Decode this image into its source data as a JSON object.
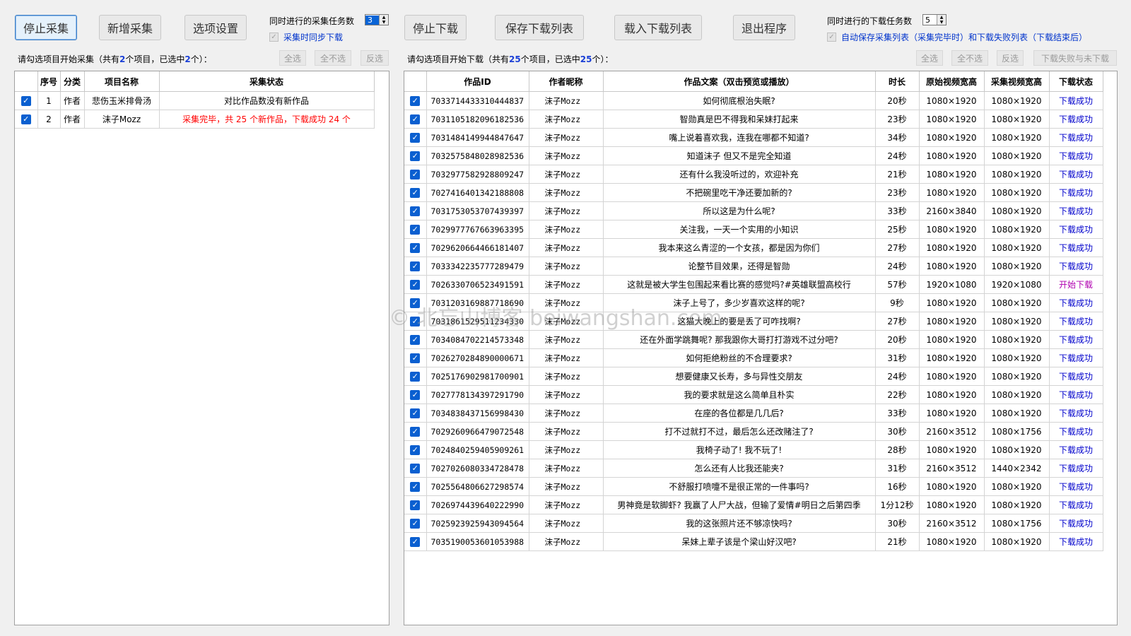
{
  "toolbar": {
    "stop_collect": "停止采集",
    "add_collect": "新增采集",
    "options": "选项设置",
    "stop_download": "停止下载",
    "save_list": "保存下载列表",
    "load_list": "载入下载列表",
    "exit": "退出程序"
  },
  "collect_settings": {
    "concurrent_label": "同时进行的采集任务数",
    "concurrent_value": "3",
    "sync_download_label": "采集时同步下载"
  },
  "download_settings": {
    "concurrent_label": "同时进行的下载任务数",
    "concurrent_value": "5",
    "autosave_label": "自动保存采集列表（采集完毕时）和下载失败列表（下载结束后）"
  },
  "left": {
    "prompt_pre": "请勾选项目开始采集（共有",
    "total": "2",
    "prompt_mid": "个项目，已选中",
    "selected": "2",
    "prompt_post": "个）：",
    "btn_all": "全选",
    "btn_none": "全不选",
    "btn_invert": "反选",
    "headers": [
      "序号",
      "分类",
      "项目名称",
      "采集状态"
    ],
    "rows": [
      {
        "no": "1",
        "cat": "作者",
        "name": "悲伤玉米排骨汤",
        "status": "对比作品数没有新作品",
        "red": false
      },
      {
        "no": "2",
        "cat": "作者",
        "name": "沫子Mozz",
        "status": "采集完毕，共 25 个新作品，下载成功 24 个",
        "red": true
      }
    ]
  },
  "right": {
    "prompt_pre": "请勾选项目开始下载（共有",
    "total": "25",
    "prompt_mid": "个项目，已选中",
    "selected": "25",
    "prompt_post": "个）：",
    "btn_all": "全选",
    "btn_none": "全不选",
    "btn_invert": "反选",
    "btn_failed": "下载失败与未下载",
    "headers": [
      "作品ID",
      "作者昵称",
      "作品文案（双击预览或播放）",
      "时长",
      "原始视频宽高",
      "采集视频宽高",
      "下载状态"
    ],
    "rows": [
      {
        "id": "7033714433310444837",
        "author": "沫子Mozz",
        "text": "如何彻底根治失眠?",
        "dur": "20秒",
        "orig": "1080×1920",
        "coll": "1080×1920",
        "status": "下载成功"
      },
      {
        "id": "7031105182096182536",
        "author": "沫子Mozz",
        "text": "智勋真是巴不得我和呆妹打起来",
        "dur": "23秒",
        "orig": "1080×1920",
        "coll": "1080×1920",
        "status": "下载成功"
      },
      {
        "id": "7031484149944847647",
        "author": "沫子Mozz",
        "text": "嘴上说着喜欢我，连我在哪都不知道?",
        "dur": "34秒",
        "orig": "1080×1920",
        "coll": "1080×1920",
        "status": "下载成功"
      },
      {
        "id": "7032575848028982536",
        "author": "沫子Mozz",
        "text": "知道沫子 但又不是完全知道",
        "dur": "24秒",
        "orig": "1080×1920",
        "coll": "1080×1920",
        "status": "下载成功"
      },
      {
        "id": "7032977582928809247",
        "author": "沫子Mozz",
        "text": "还有什么我没听过的，欢迎补充",
        "dur": "21秒",
        "orig": "1080×1920",
        "coll": "1080×1920",
        "status": "下载成功"
      },
      {
        "id": "7027416401342188808",
        "author": "沫子Mozz",
        "text": "不把碗里吃干净还要加新的?",
        "dur": "23秒",
        "orig": "1080×1920",
        "coll": "1080×1920",
        "status": "下载成功"
      },
      {
        "id": "7031753053707439397",
        "author": "沫子Mozz",
        "text": "所以这是为什么呢?",
        "dur": "33秒",
        "orig": "2160×3840",
        "coll": "1080×1920",
        "status": "下载成功"
      },
      {
        "id": "7029977767663963395",
        "author": "沫子Mozz",
        "text": "关注我，一天一个实用的小知识",
        "dur": "25秒",
        "orig": "1080×1920",
        "coll": "1080×1920",
        "status": "下载成功"
      },
      {
        "id": "7029620664466181407",
        "author": "沫子Mozz",
        "text": "我本来这么青涩的一个女孩，都是因为你们",
        "dur": "27秒",
        "orig": "1080×1920",
        "coll": "1080×1920",
        "status": "下载成功"
      },
      {
        "id": "7033342235777289479",
        "author": "沫子Mozz",
        "text": "论整节目效果，还得是智勋",
        "dur": "24秒",
        "orig": "1080×1920",
        "coll": "1080×1920",
        "status": "下载成功"
      },
      {
        "id": "7026330706523491591",
        "author": "沫子Mozz",
        "text": "这就是被大学生包围起来看比赛的感觉吗?#英雄联盟高校行",
        "dur": "57秒",
        "orig": "1920×1080",
        "coll": "1920×1080",
        "status": "开始下载"
      },
      {
        "id": "7031203169887718690",
        "author": "沫子Mozz",
        "text": "沫子上号了，多少岁喜欢这样的呢?",
        "dur": "9秒",
        "orig": "1080×1920",
        "coll": "1080×1920",
        "status": "下载成功"
      },
      {
        "id": "7031861529511234330",
        "author": "沫子Mozz",
        "text": "这猫大晚上的要是丢了可咋找啊?",
        "dur": "27秒",
        "orig": "1080×1920",
        "coll": "1080×1920",
        "status": "下载成功"
      },
      {
        "id": "7034084702214573348",
        "author": "沫子Mozz",
        "text": "还在外面学跳舞呢? 那我跟你大哥打打游戏不过分吧?",
        "dur": "20秒",
        "orig": "1080×1920",
        "coll": "1080×1920",
        "status": "下载成功"
      },
      {
        "id": "7026270284890000671",
        "author": "沫子Mozz",
        "text": "如何拒绝粉丝的不合理要求?",
        "dur": "31秒",
        "orig": "1080×1920",
        "coll": "1080×1920",
        "status": "下载成功"
      },
      {
        "id": "7025176902981700901",
        "author": "沫子Mozz",
        "text": "想要健康又长寿，多与异性交朋友",
        "dur": "24秒",
        "orig": "1080×1920",
        "coll": "1080×1920",
        "status": "下载成功"
      },
      {
        "id": "7027778134397291790",
        "author": "沫子Mozz",
        "text": "我的要求就是这么简单且朴实",
        "dur": "22秒",
        "orig": "1080×1920",
        "coll": "1080×1920",
        "status": "下载成功"
      },
      {
        "id": "7034838437156998430",
        "author": "沫子Mozz",
        "text": "在座的各位都是几几后?",
        "dur": "33秒",
        "orig": "1080×1920",
        "coll": "1080×1920",
        "status": "下载成功"
      },
      {
        "id": "7029260966479072548",
        "author": "沫子Mozz",
        "text": "打不过就打不过，最后怎么还改赌注了?",
        "dur": "30秒",
        "orig": "2160×3512",
        "coll": "1080×1756",
        "status": "下载成功"
      },
      {
        "id": "7024840259405909261",
        "author": "沫子Mozz",
        "text": "我椅子动了! 我不玩了!",
        "dur": "28秒",
        "orig": "1080×1920",
        "coll": "1080×1920",
        "status": "下载成功"
      },
      {
        "id": "7027026080334728478",
        "author": "沫子Mozz",
        "text": "怎么还有人比我还能夹?",
        "dur": "31秒",
        "orig": "2160×3512",
        "coll": "1440×2342",
        "status": "下载成功"
      },
      {
        "id": "7025564806627298574",
        "author": "沫子Mozz",
        "text": "不舒服打喷嚏不是很正常的一件事吗?",
        "dur": "16秒",
        "orig": "1080×1920",
        "coll": "1080×1920",
        "status": "下载成功"
      },
      {
        "id": "7026974439640222990",
        "author": "沫子Mozz",
        "text": "男神竟是软脚虾? 我赢了人尸大战，但输了爱情#明日之后第四季",
        "dur": "1分12秒",
        "orig": "1080×1920",
        "coll": "1080×1920",
        "status": "下载成功"
      },
      {
        "id": "7025923925943094564",
        "author": "沫子Mozz",
        "text": "我的这张照片还不够凉快吗?",
        "dur": "30秒",
        "orig": "2160×3512",
        "coll": "1080×1756",
        "status": "下载成功"
      },
      {
        "id": "7035190053601053988",
        "author": "沫子Mozz",
        "text": "呆妹上辈子该是个梁山好汉吧?",
        "dur": "21秒",
        "orig": "1080×1920",
        "coll": "1080×1920",
        "status": "下载成功"
      }
    ]
  },
  "watermark": "© 北忘山博客 beiwangshan.com",
  "colors": {
    "accent": "#0a5fd0",
    "status_ok": "#0000cc",
    "status_start": "#b000b0",
    "status_red": "#ff0000",
    "count_hl": "#1a3fd6"
  }
}
